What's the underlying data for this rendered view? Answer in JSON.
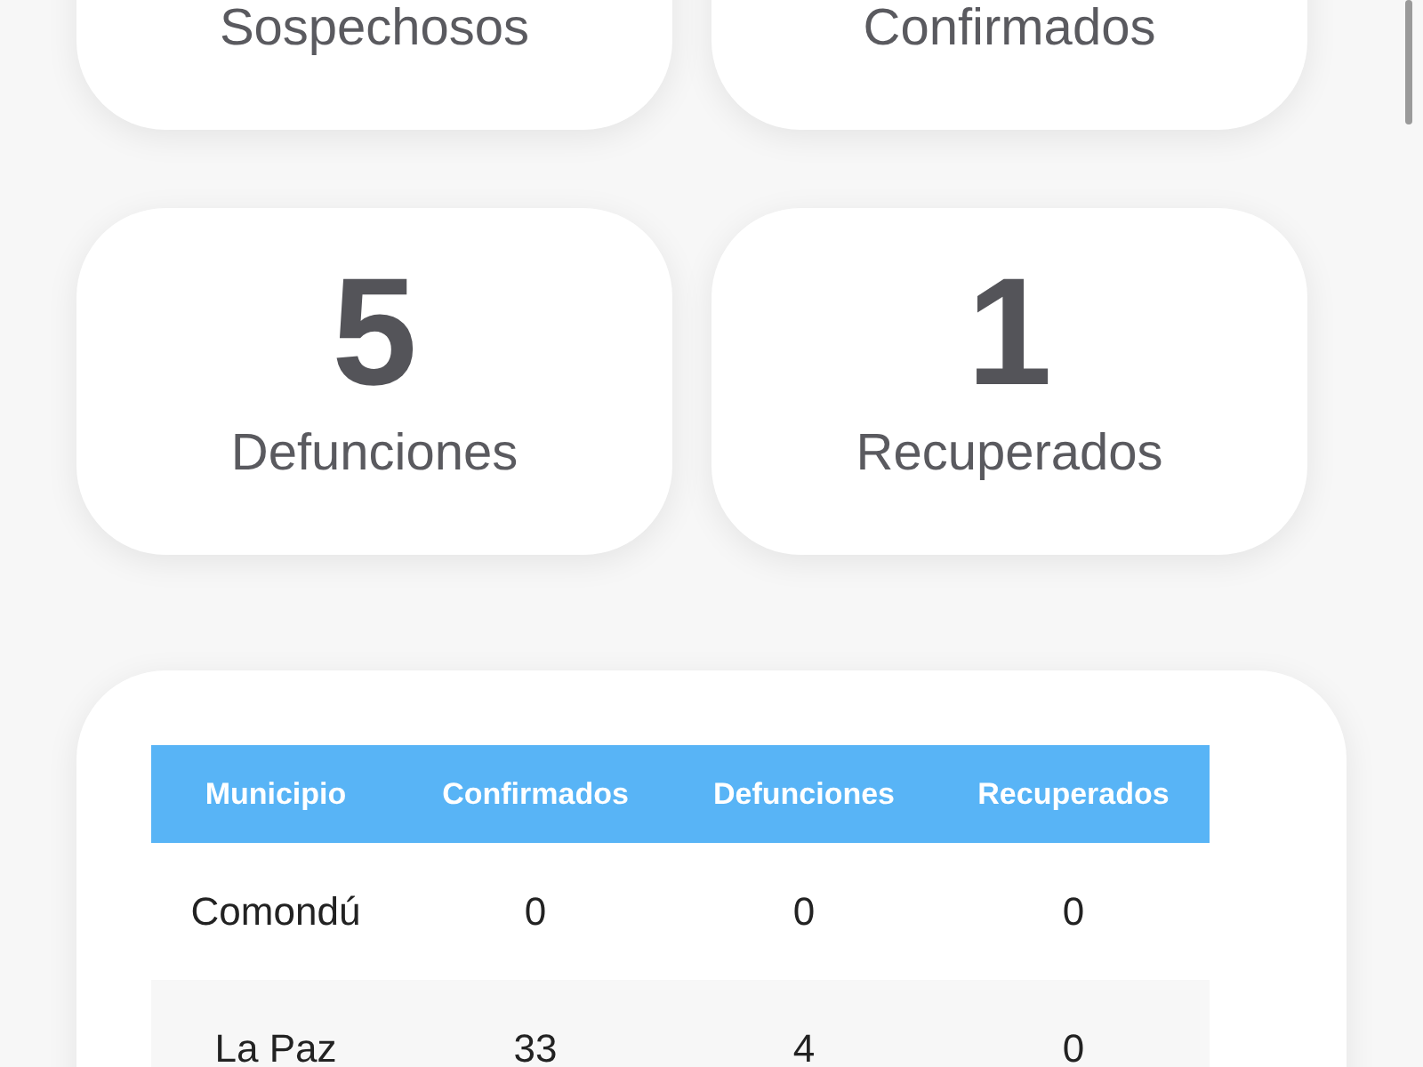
{
  "stats": [
    {
      "label": "Sospechosos"
    },
    {
      "label": "Confirmados"
    },
    {
      "value": "5",
      "label": "Defunciones"
    },
    {
      "value": "1",
      "label": "Recuperados"
    }
  ],
  "table": {
    "columns": [
      "Municipio",
      "Confirmados",
      "Defunciones",
      "Recuperados"
    ],
    "rows": [
      [
        "Comondú",
        "0",
        "0",
        "0"
      ],
      [
        "La Paz",
        "33",
        "4",
        "0"
      ]
    ]
  }
}
